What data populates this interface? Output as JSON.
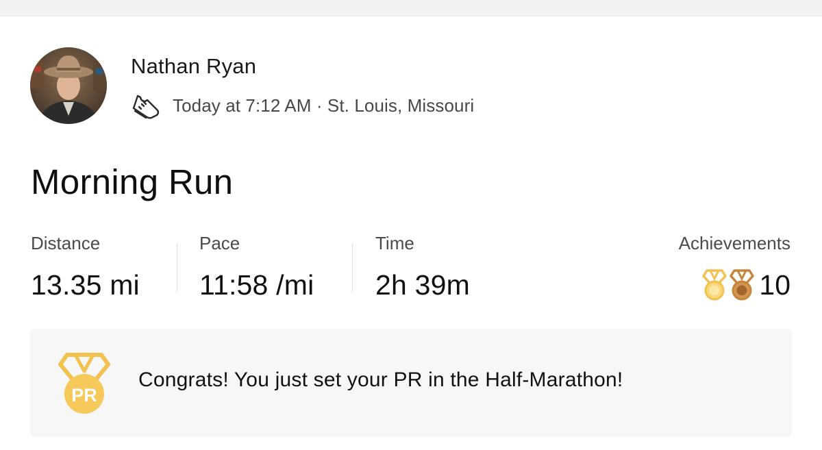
{
  "athlete": {
    "name": "Nathan Ryan",
    "avatar_icon": "person-avatar"
  },
  "activity": {
    "type_icon": "run-shoe-icon",
    "timestamp": "Today at 7:12 AM",
    "separator": " · ",
    "location": "St. Louis, Missouri",
    "title": "Morning Run"
  },
  "stats": [
    {
      "label": "Distance",
      "value": "13.35 mi"
    },
    {
      "label": "Pace",
      "value": "11:58 /mi"
    },
    {
      "label": "Time",
      "value": "2h 39m"
    }
  ],
  "achievements": {
    "label": "Achievements",
    "count": "10",
    "medals": [
      "gold-medal-icon",
      "bronze-medal-icon"
    ]
  },
  "pr_banner": {
    "badge_text": "PR",
    "message": "Congrats! You just set your PR in the Half-Marathon!"
  },
  "colors": {
    "gold": "#f2c14e",
    "gold_light": "#f7d87a",
    "bronze": "#c8843a",
    "bronze_dark": "#a5652a",
    "banner_bg": "#f7f7f7"
  }
}
